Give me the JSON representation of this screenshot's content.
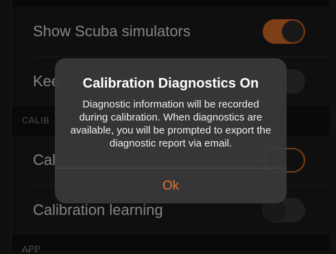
{
  "settings": {
    "rows": [
      {
        "label": "Show Scuba simulators",
        "toggle": "on"
      },
      {
        "label": "Kee",
        "toggle": "off"
      },
      {
        "label": "Cal",
        "toggle": "outline"
      },
      {
        "label": "Calibration learning",
        "toggle": "off"
      }
    ],
    "sections": {
      "calibration": "CALIB",
      "app": "APP"
    }
  },
  "dialog": {
    "title": "Calibration Diagnostics On",
    "message": "Diagnostic information will be recorded during calibration.  When diagnostics are available, you will be prompted to export the diagnostic report via email.",
    "button_label": "Ok"
  },
  "colors": {
    "accent": "#e3742a",
    "background": "#111111",
    "row_background": "#1c1c1d",
    "dialog_background": "#3a3a3c"
  }
}
